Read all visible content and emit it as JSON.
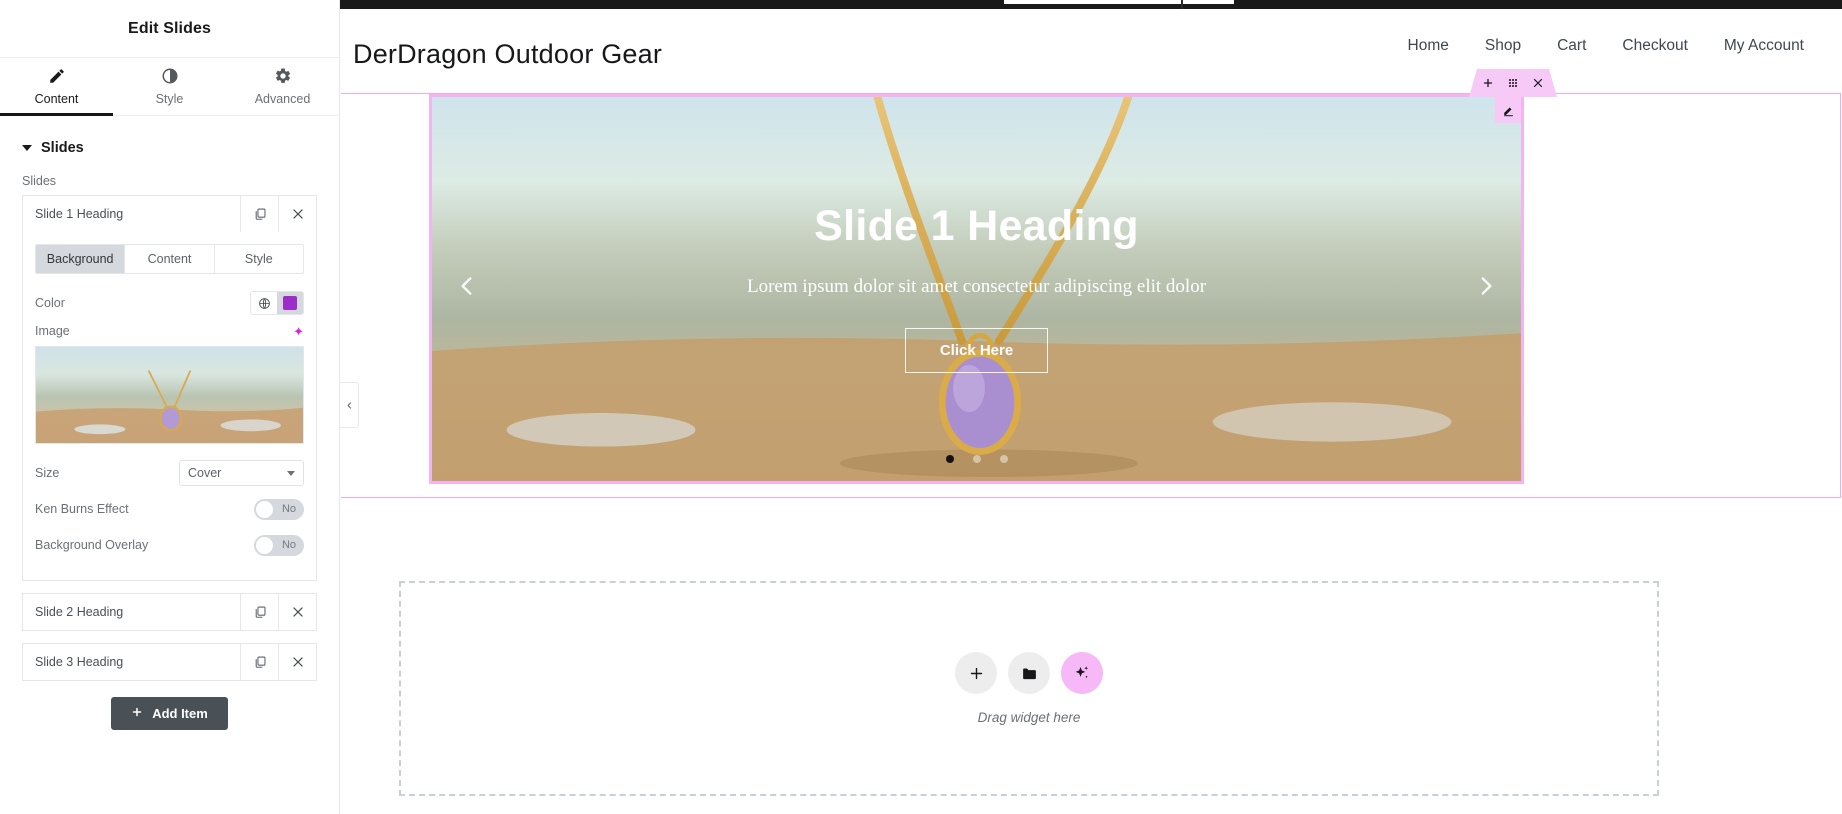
{
  "panel": {
    "title": "Edit Slides",
    "tabs": [
      {
        "label": "Content",
        "icon": "pencil-icon",
        "active": true
      },
      {
        "label": "Style",
        "icon": "contrast-icon",
        "active": false
      },
      {
        "label": "Advanced",
        "icon": "gear-icon",
        "active": false
      }
    ],
    "section_title": "Slides",
    "repeater_label": "Slides",
    "slides": [
      {
        "title": "Slide 1 Heading",
        "expanded": true
      },
      {
        "title": "Slide 2 Heading",
        "expanded": false
      },
      {
        "title": "Slide 3 Heading",
        "expanded": false
      }
    ],
    "subtabs": [
      {
        "label": "Background",
        "active": true
      },
      {
        "label": "Content",
        "active": false
      },
      {
        "label": "Style",
        "active": false
      }
    ],
    "controls": {
      "color_label": "Color",
      "color_value": "#9b2dc9",
      "globe_icon": "globe-icon",
      "image_label": "Image",
      "image_ai_icon": "ai-sparkle-icon",
      "size_label": "Size",
      "size_value": "Cover",
      "ken_burns_label": "Ken Burns Effect",
      "ken_burns_value": "No",
      "overlay_label": "Background Overlay",
      "overlay_value": "No"
    },
    "add_item_label": "Add Item",
    "collapse_icon": "chevron-left-icon"
  },
  "site": {
    "title": "DerDragon Outdoor Gear",
    "nav": [
      "Home",
      "Shop",
      "Cart",
      "Checkout",
      "My Account"
    ]
  },
  "widget_toolbar": {
    "add_icon": "plus-icon",
    "drag_icon": "drag-handle-icon",
    "close_icon": "close-icon",
    "edit_icon": "pencil-edit-icon",
    "accent": "#f6c9f6"
  },
  "slider": {
    "heading": "Slide 1 Heading",
    "subheading": "Lorem ipsum dolor sit amet consectetur adipiscing elit dolor",
    "button_label": "Click Here",
    "prev_icon": "chevron-left-icon",
    "next_icon": "chevron-right-icon",
    "dots": 3,
    "active_dot": 1
  },
  "dropzone": {
    "text": "Drag widget here",
    "buttons": [
      {
        "icon": "plus-icon",
        "name": "add-widget"
      },
      {
        "icon": "folder-icon",
        "name": "open-library"
      },
      {
        "icon": "ai-sparkle-icon",
        "name": "ai-builder"
      }
    ]
  }
}
